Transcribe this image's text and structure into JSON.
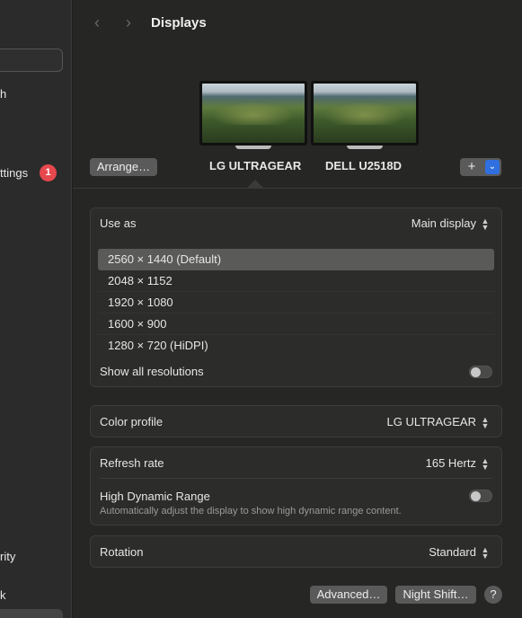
{
  "sidebar": {
    "items": [
      {
        "label": "h"
      },
      {
        "label": "ttings"
      },
      {
        "label": "rity"
      },
      {
        "label": "k"
      }
    ],
    "badge_count": "1"
  },
  "toolbar": {
    "back_icon": "chevron-left-icon",
    "forward_icon": "chevron-right-icon",
    "title": "Displays"
  },
  "displays": {
    "arrange_label": "Arrange…",
    "monitors": [
      {
        "name": "LG ULTRAGEAR",
        "selected": true
      },
      {
        "name": "DELL U2518D",
        "selected": false
      }
    ],
    "add_icon": "plus-icon",
    "add_menu_icon": "chevron-down-icon"
  },
  "settings": {
    "use_as": {
      "label": "Use as",
      "value": "Main display"
    },
    "resolutions": [
      "2560 × 1440 (Default)",
      "2048 × 1152",
      "1920 × 1080",
      "1600 × 900",
      "1280 × 720 (HiDPI)"
    ],
    "selected_resolution": "2560 × 1440 (Default)",
    "show_all": {
      "label": "Show all resolutions",
      "on": false
    },
    "color_profile": {
      "label": "Color profile",
      "value": "LG ULTRAGEAR"
    },
    "refresh_rate": {
      "label": "Refresh rate",
      "value": "165 Hertz"
    },
    "hdr": {
      "label": "High Dynamic Range",
      "description": "Automatically adjust the display to show high dynamic range content.",
      "on": false
    },
    "rotation": {
      "label": "Rotation",
      "value": "Standard"
    }
  },
  "footer": {
    "advanced_label": "Advanced…",
    "night_shift_label": "Night Shift…",
    "help_label": "?"
  },
  "colors": {
    "accent": "#2f6fe0",
    "badge": "#e5484d",
    "window_bg": "#262624",
    "sidebar_bg": "#2b2b2b"
  }
}
